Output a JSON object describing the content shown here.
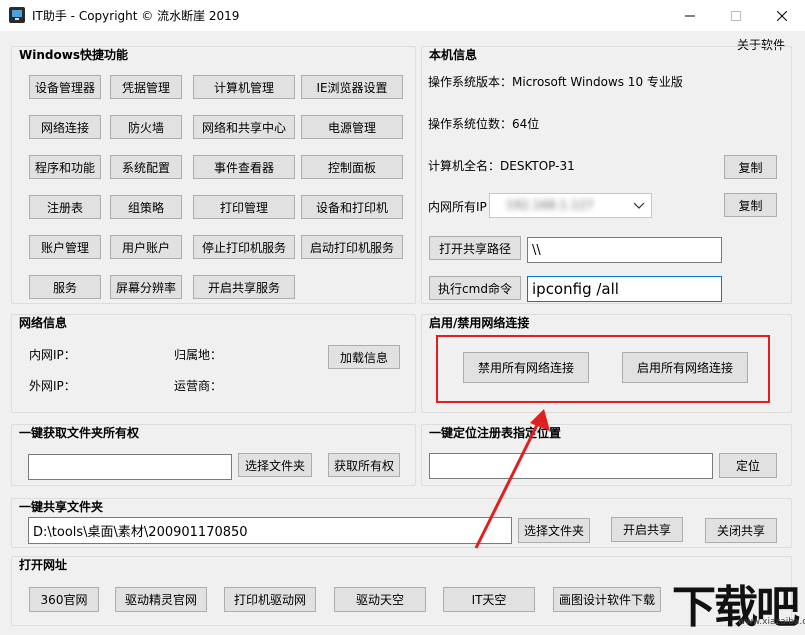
{
  "window": {
    "title": "IT助手 - Copyright © 流水断崖 2019",
    "menu_about": "关于软件",
    "icons": {
      "minimize": "minimize-icon",
      "maximize": "maximize-icon",
      "close": "close-icon"
    }
  },
  "windows_shortcuts": {
    "title": "Windows快捷功能",
    "rows": [
      [
        "设备管理器",
        "凭据管理",
        "计算机管理",
        "IE浏览器设置"
      ],
      [
        "网络连接",
        "防火墙",
        "网络和共享中心",
        "电源管理"
      ],
      [
        "程序和功能",
        "系统配置",
        "事件查看器",
        "控制面板"
      ],
      [
        "注册表",
        "组策略",
        "打印管理",
        "设备和打印机"
      ],
      [
        "账户管理",
        "用户账户",
        "停止打印机服务",
        "启动打印机服务"
      ],
      [
        "服务",
        "屏幕分辨率",
        "开启共享服务"
      ]
    ]
  },
  "local_info": {
    "title": "本机信息",
    "os_version": "操作系统版本：Microsoft Windows 10 专业版",
    "os_bits": "操作系统位数：64位",
    "computer_name": "计算机全名：DESKTOP-31",
    "copy_label": "复制",
    "intranet_ip_label": "内网所有IP",
    "intranet_ip_value": "192.168.1.127",
    "copy_label_2": "复制",
    "open_share_path_label": "打开共享路径",
    "share_path_value": "\\\\",
    "exec_cmd_label": "执行cmd命令",
    "cmd_value": "ipconfig /all"
  },
  "network_info": {
    "title": "网络信息",
    "intranet_ip": "内网IP：",
    "location": "归属地：",
    "extranet_ip": "外网IP：",
    "isp": "运营商：",
    "load_button": "加载信息"
  },
  "network_toggle": {
    "title": "启用/禁用网络连接",
    "disable_all": "禁用所有网络连接",
    "enable_all": "启用所有网络连接"
  },
  "folder_owner": {
    "title": "一键获取文件夹所有权",
    "path_value": "",
    "choose_folder": "选择文件夹",
    "take_ownership": "获取所有权"
  },
  "registry_locate": {
    "title": "一键定位注册表指定位置",
    "path_value": "",
    "locate": "定位"
  },
  "share_folder": {
    "title": "一键共享文件夹",
    "path_value": "D:\\tools\\桌面\\素材\\200901170850",
    "choose_folder": "选择文件夹",
    "start_share": "开启共享",
    "stop_share": "关闭共享"
  },
  "open_urls": {
    "title": "打开网址",
    "buttons": [
      "360官网",
      "驱动精灵官网",
      "打印机驱动网",
      "驱动天空",
      "IT天空",
      "画图设计软件下载"
    ]
  },
  "watermark": {
    "text": "下载吧",
    "url": "www.xiazaiba.com"
  },
  "colors": {
    "highlight": "#e02020",
    "focus_border": "#0078d7",
    "button_bg": "#e1e1e1"
  }
}
